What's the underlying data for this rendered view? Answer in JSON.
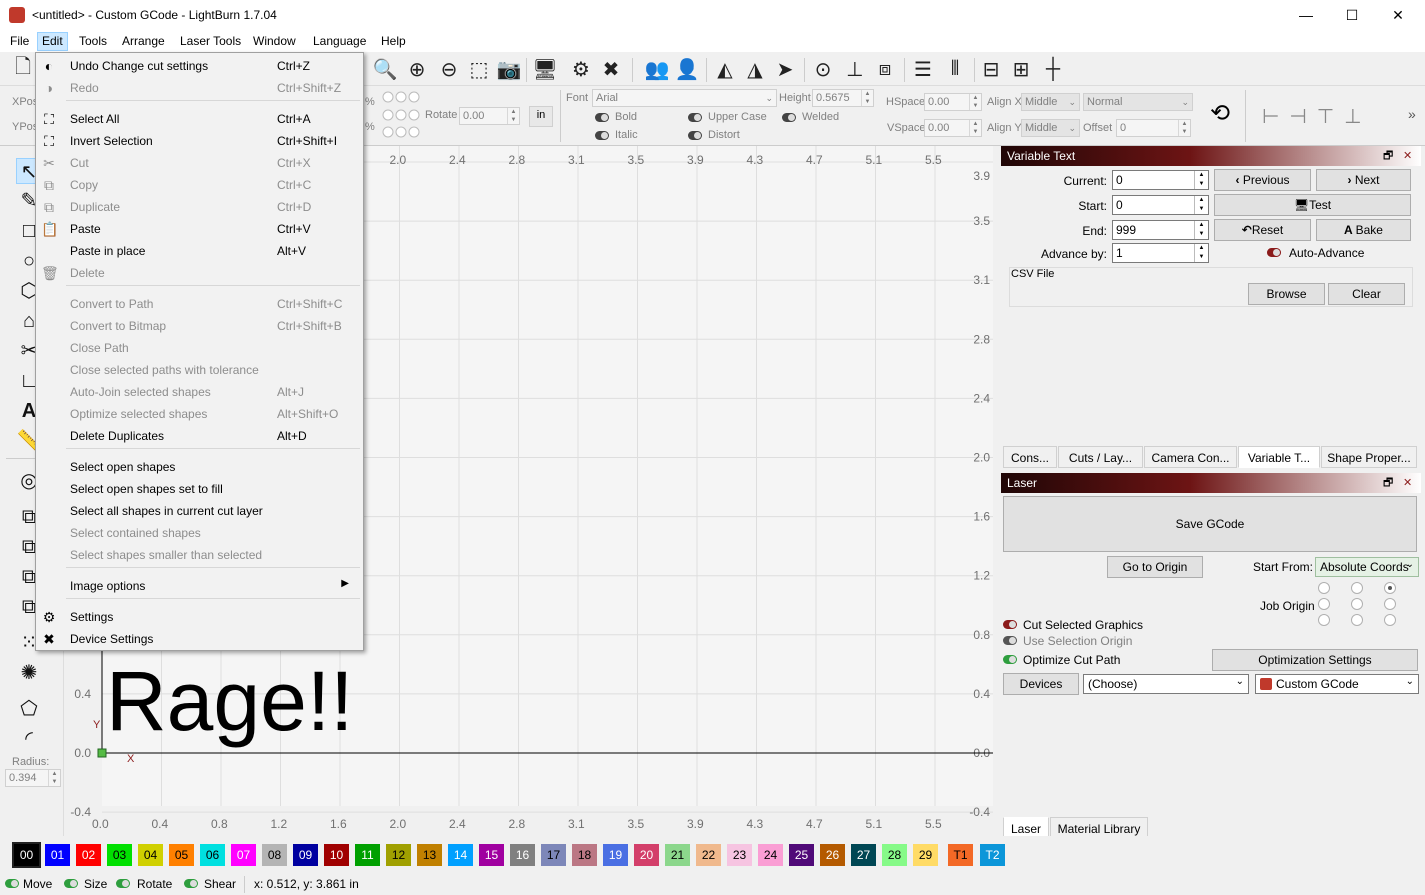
{
  "window": {
    "title": "<untitled> - Custom GCode - LightBurn 1.7.04",
    "minimize": "—",
    "maximize": "☐",
    "close": "✕"
  },
  "menubar": [
    "File",
    "Edit",
    "Tools",
    "Arrange",
    "Laser Tools",
    "Window",
    "Language",
    "Help"
  ],
  "edit_menu": {
    "items": [
      {
        "label": "Undo Change cut settings",
        "shortcut": "Ctrl+Z",
        "enabled": true,
        "icon": "undo-icon"
      },
      {
        "label": "Redo",
        "shortcut": "Ctrl+Shift+Z",
        "enabled": false,
        "icon": "redo-icon"
      },
      {
        "label": "Select All",
        "shortcut": "Ctrl+A",
        "enabled": true,
        "icon": "select-all-icon"
      },
      {
        "label": "Invert Selection",
        "shortcut": "Ctrl+Shift+I",
        "enabled": true,
        "icon": "invert-selection-icon"
      },
      {
        "label": "Cut",
        "shortcut": "Ctrl+X",
        "enabled": false,
        "icon": "scissors-icon"
      },
      {
        "label": "Copy",
        "shortcut": "Ctrl+C",
        "enabled": false,
        "icon": "copy-icon"
      },
      {
        "label": "Duplicate",
        "shortcut": "Ctrl+D",
        "enabled": false,
        "icon": "duplicate-icon"
      },
      {
        "label": "Paste",
        "shortcut": "Ctrl+V",
        "enabled": true,
        "icon": "paste-icon"
      },
      {
        "label": "Paste in place",
        "shortcut": "Alt+V",
        "enabled": true,
        "icon": ""
      },
      {
        "label": "Delete",
        "shortcut": "",
        "enabled": false,
        "icon": "trash-icon"
      },
      {
        "label": "Convert to Path",
        "shortcut": "Ctrl+Shift+C",
        "enabled": false,
        "icon": ""
      },
      {
        "label": "Convert to Bitmap",
        "shortcut": "Ctrl+Shift+B",
        "enabled": false,
        "icon": ""
      },
      {
        "label": "Close Path",
        "shortcut": "",
        "enabled": false,
        "icon": ""
      },
      {
        "label": "Close selected paths with tolerance",
        "shortcut": "",
        "enabled": false,
        "icon": ""
      },
      {
        "label": "Auto-Join selected shapes",
        "shortcut": "Alt+J",
        "enabled": false,
        "icon": ""
      },
      {
        "label": "Optimize selected shapes",
        "shortcut": "Alt+Shift+O",
        "enabled": false,
        "icon": ""
      },
      {
        "label": "Delete Duplicates",
        "shortcut": "Alt+D",
        "enabled": true,
        "icon": ""
      },
      {
        "label": "Select open shapes",
        "shortcut": "",
        "enabled": true,
        "icon": ""
      },
      {
        "label": "Select open shapes set to fill",
        "shortcut": "",
        "enabled": true,
        "icon": ""
      },
      {
        "label": "Select all shapes in current cut layer",
        "shortcut": "",
        "enabled": true,
        "icon": ""
      },
      {
        "label": "Select contained shapes",
        "shortcut": "",
        "enabled": false,
        "icon": ""
      },
      {
        "label": "Select shapes smaller than selected",
        "shortcut": "",
        "enabled": false,
        "icon": ""
      },
      {
        "label": "Image options",
        "shortcut": "",
        "enabled": true,
        "icon": "",
        "submenu": true
      },
      {
        "label": "Settings",
        "shortcut": "",
        "enabled": true,
        "icon": "gears-icon"
      },
      {
        "label": "Device Settings",
        "shortcut": "",
        "enabled": true,
        "icon": "tools-icon"
      }
    ]
  },
  "props": {
    "xpos_label": "XPos",
    "ypos_label": "YPos",
    "pct1": "%",
    "pct2": "%",
    "rotate_label": "Rotate",
    "rotate_value": "0.00",
    "units_btn": "in",
    "font_label": "Font",
    "font_value": "Arial",
    "height_label": "Height",
    "height_value": "0.5675",
    "hspace_label": "HSpace",
    "hspace_value": "0.00",
    "vspace_label": "VSpace",
    "vspace_value": "0.00",
    "alignx_label": "Align X",
    "alignx_value": "Middle",
    "aligny_label": "Align Y",
    "aligny_value": "Middle",
    "normal_value": "Normal",
    "offset_label": "Offset",
    "offset_value": "0",
    "bold": "Bold",
    "italic": "Italic",
    "upper_case": "Upper Case",
    "distort": "Distort",
    "welded": "Welded"
  },
  "leftbar": {
    "radius_label": "Radius:",
    "radius_value": "0.394"
  },
  "canvas": {
    "text": "Rage!!",
    "x_ticks": [
      "0.0",
      "0.4",
      "0.8",
      "1.2",
      "1.6",
      "2.0",
      "2.4",
      "2.8",
      "3.1",
      "3.5",
      "3.9",
      "4.3",
      "4.7",
      "5.1",
      "5.5"
    ],
    "top_x_ticks": [
      "2.0",
      "2.4",
      "2.8",
      "3.1",
      "3.5",
      "3.9",
      "4.3",
      "4.7",
      "5.1",
      "5.5"
    ],
    "y_ticks": [
      "3.9",
      "3.5",
      "3.1",
      "2.8",
      "2.4",
      "2.0",
      "1.6",
      "1.2",
      "0.8",
      "0.4",
      "0.0",
      "-0.4"
    ],
    "left_y_ticks": [
      "0.4",
      "0.0",
      "-0.4"
    ],
    "x_axis_label": "X",
    "y_axis_label": "Y"
  },
  "variable_text": {
    "title": "Variable Text",
    "current_label": "Current:",
    "current_value": "0",
    "start_label": "Start:",
    "start_value": "0",
    "end_label": "End:",
    "end_value": "999",
    "advance_label": "Advance by:",
    "advance_value": "1",
    "previous": "Previous",
    "next": "Next",
    "test": "Test",
    "reset": "Reset",
    "bake": "Bake",
    "auto_advance": "Auto-Advance",
    "csv_label": "CSV File",
    "browse": "Browse",
    "clear": "Clear"
  },
  "top_tabs": [
    "Cons...",
    "Cuts / Lay...",
    "Camera Con...",
    "Variable T...",
    "Shape Proper..."
  ],
  "laser": {
    "title": "Laser",
    "save_gcode": "Save GCode",
    "go_to_origin": "Go to Origin",
    "start_from_label": "Start From:",
    "start_from_value": "Absolute Coords",
    "job_origin_label": "Job Origin",
    "cut_selected": "Cut Selected Graphics",
    "use_selection_origin": "Use Selection Origin",
    "optimize_cut_path": "Optimize Cut Path",
    "optimization_settings": "Optimization Settings",
    "devices": "Devices",
    "device_choice": "(Choose)",
    "device_profile": "Custom GCode"
  },
  "bottom_tabs": [
    "Laser",
    "Material Library"
  ],
  "palette": [
    {
      "label": "00",
      "color": "#000000",
      "text": "#ffffff"
    },
    {
      "label": "01",
      "color": "#0000ff",
      "text": "#ffffff"
    },
    {
      "label": "02",
      "color": "#ff0000",
      "text": "#ffffff"
    },
    {
      "label": "03",
      "color": "#00e000",
      "text": "#000000"
    },
    {
      "label": "04",
      "color": "#d0d000",
      "text": "#000000"
    },
    {
      "label": "05",
      "color": "#ff8000",
      "text": "#000000"
    },
    {
      "label": "06",
      "color": "#00e0e0",
      "text": "#000000"
    },
    {
      "label": "07",
      "color": "#ff00ff",
      "text": "#ffffff"
    },
    {
      "label": "08",
      "color": "#b4b4b4",
      "text": "#000000"
    },
    {
      "label": "09",
      "color": "#0000a0",
      "text": "#ffffff"
    },
    {
      "label": "10",
      "color": "#a00000",
      "text": "#ffffff"
    },
    {
      "label": "11",
      "color": "#00a000",
      "text": "#ffffff"
    },
    {
      "label": "12",
      "color": "#a0a000",
      "text": "#000000"
    },
    {
      "label": "13",
      "color": "#c08000",
      "text": "#000000"
    },
    {
      "label": "14",
      "color": "#00a0ff",
      "text": "#ffffff"
    },
    {
      "label": "15",
      "color": "#a000a0",
      "text": "#ffffff"
    },
    {
      "label": "16",
      "color": "#808080",
      "text": "#ffffff"
    },
    {
      "label": "17",
      "color": "#7d87b9",
      "text": "#000000"
    },
    {
      "label": "18",
      "color": "#bb7784",
      "text": "#000000"
    },
    {
      "label": "19",
      "color": "#4a6fe3",
      "text": "#ffffff"
    },
    {
      "label": "20",
      "color": "#d33f6a",
      "text": "#ffffff"
    },
    {
      "label": "21",
      "color": "#8cd78c",
      "text": "#000000"
    },
    {
      "label": "22",
      "color": "#f0b98d",
      "text": "#000000"
    },
    {
      "label": "23",
      "color": "#f6c4e1",
      "text": "#000000"
    },
    {
      "label": "24",
      "color": "#fa9ed4",
      "text": "#000000"
    },
    {
      "label": "25",
      "color": "#500a78",
      "text": "#ffffff"
    },
    {
      "label": "26",
      "color": "#b45a00",
      "text": "#ffffff"
    },
    {
      "label": "27",
      "color": "#004754",
      "text": "#ffffff"
    },
    {
      "label": "28",
      "color": "#86fa88",
      "text": "#000000"
    },
    {
      "label": "29",
      "color": "#ffdb66",
      "text": "#000000"
    },
    {
      "label": "T1",
      "color": "#f36926",
      "text": "#000000"
    },
    {
      "label": "T2",
      "color": "#0c96d9",
      "text": "#ffffff"
    }
  ],
  "status": {
    "move": "Move",
    "size": "Size",
    "rotate": "Rotate",
    "shear": "Shear",
    "coords": "x: 0.512, y: 3.861 in"
  }
}
